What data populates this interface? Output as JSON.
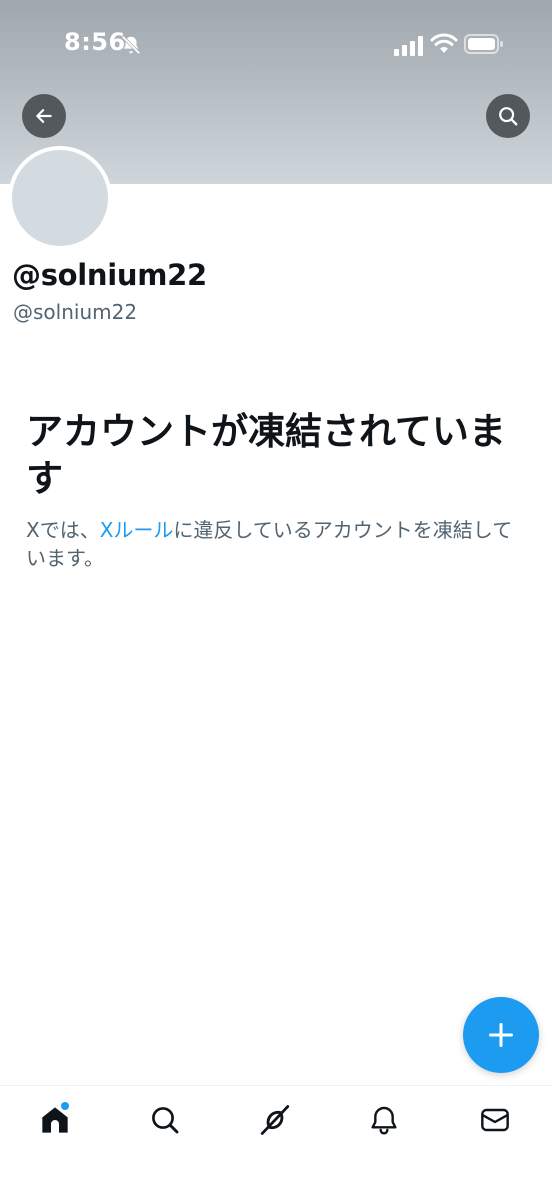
{
  "status_bar": {
    "time": "8:56",
    "icons": [
      "bell-mute-icon",
      "signal-icon",
      "wifi-icon",
      "battery-icon"
    ]
  },
  "header": {
    "back_icon": "arrow-left-icon",
    "search_icon": "search-icon"
  },
  "profile": {
    "display_name": "@solnium22",
    "handle": "@solnium22"
  },
  "suspended": {
    "title": "アカウントが凍結されています",
    "body_prefix": "Xでは、",
    "rules_link": "Xルール",
    "body_suffix": "に違反しているアカウントを凍結しています。"
  },
  "compose": {
    "icon": "plus-icon"
  },
  "bottom_nav": {
    "items": [
      "home-icon",
      "search-icon",
      "grok-icon",
      "bell-icon",
      "mail-icon"
    ],
    "active": "home-icon",
    "home_has_notification": true
  },
  "colors": {
    "accent": "#1d9bf0",
    "text_primary": "#0f1419",
    "text_secondary": "#536471"
  }
}
